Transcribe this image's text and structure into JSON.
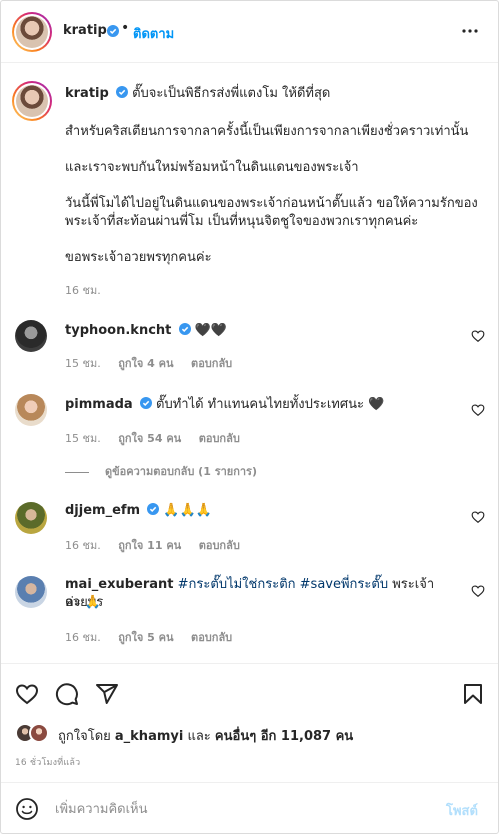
{
  "header": {
    "username": "kratip",
    "dot": "•",
    "follow_label": "ติดตาม"
  },
  "caption": {
    "username": "kratip",
    "line1": "ตั๊บจะเป็นพิธีกรส่งพี่แตงโม ให้ดีที่สุด",
    "line2": "สำหรับคริสเตียนการจากลาครั้งนี้เป็นเพียงการจากลาเพียงชั่วคราวเท่านั้น",
    "line3": "และเราจะพบกันใหม่พร้อมหน้าในดินแดนของพระเจ้า",
    "line4a": "วันนี้พี่โมได้ไปอยู่ในดินแดนของพระเจ้าก่อนหน้าตั๊บแล้ว ขอให้ความรักของ",
    "line4b": "พระเจ้าที่สะท้อนผ่านพี่โม เป็นที่หนุนจิตชูใจของพวกเราทุกคนค่ะ",
    "line5": "ขอพระเจ้าอวยพรทุกคนค่ะ",
    "time": "16 ชม."
  },
  "comments": [
    {
      "username": "typhoon.kncht",
      "text": "🖤🖤",
      "time": "15 ชม.",
      "likes": "ถูกใจ 4 คน",
      "reply": "ตอบกลับ"
    },
    {
      "username": "pimmada",
      "text": "ตั๊บทำได้ ทำแทนคนไทยทั้งประเทศนะ 🖤",
      "time": "15 ชม.",
      "likes": "ถูกใจ 54 คน",
      "reply": "ตอบกลับ",
      "view_replies": "ดูข้อความตอบกลับ (1 รายการ)"
    },
    {
      "username": "djjem_efm",
      "text": "🙏🙏🙏",
      "time": "16 ชม.",
      "likes": "ถูกใจ 11 คน",
      "reply": "ตอบกลับ"
    },
    {
      "username": "mai_exuberant",
      "tag1": "#กระตั๊บไม่ใช่กระติก",
      "tag2": "#saveพี่กระตั๊บ",
      "text_after": "พระเจ้าอวยพร",
      "line2": "ค่ะ 🙏",
      "time": "16 ชม.",
      "likes": "ถูกใจ 5 คน",
      "reply": "ตอบกลับ"
    }
  ],
  "likes_summary": {
    "prefix": "ถูกใจโดย",
    "user": "a_khamyi",
    "and": "และ",
    "others": "คนอื่นๆ อีก 11,087 คน"
  },
  "time_ago": "16 ชั่วโมงที่แล้ว",
  "add_comment": {
    "placeholder": "เพิ่มความคิดเห็น",
    "post_label": "โพสต์"
  },
  "colors": {
    "accent": "#0095f6",
    "verified": "#3897f0",
    "muted": "#8e8e8e",
    "post_disabled": "#b2dffc",
    "hashtag": "#00376b"
  }
}
